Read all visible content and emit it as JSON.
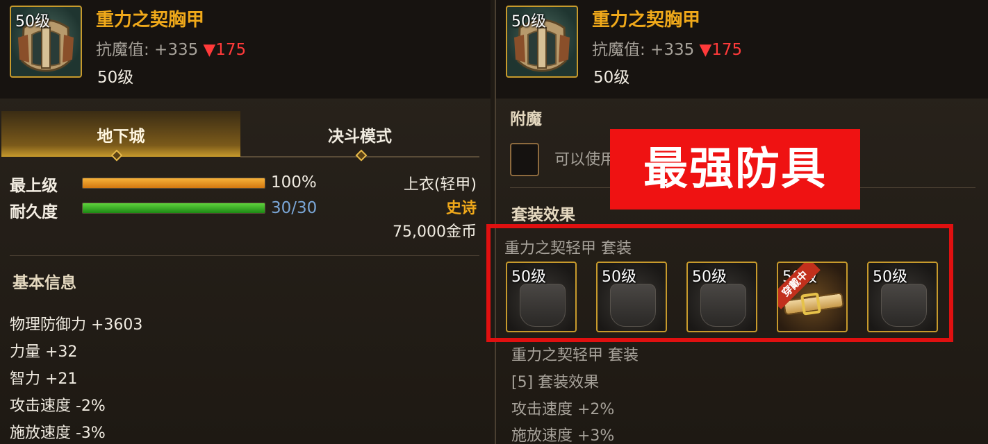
{
  "left_panel": {
    "item": {
      "icon_level": "50级",
      "name": "重力之契胸甲",
      "stat_text": "抗魔值: +335",
      "stat_down": "▼175",
      "level": "50级"
    },
    "tabs": [
      {
        "label": "地下城",
        "active": true
      },
      {
        "label": "决斗模式",
        "active": false
      }
    ],
    "grade": {
      "label": "最上级",
      "value_text": "100%",
      "percent": 100,
      "value_color": "#f1ece2"
    },
    "durability": {
      "label": "耐久度",
      "value_text": "30/30",
      "percent": 100,
      "value_color": "#7aa6d6"
    },
    "type": {
      "slot": "上衣(轻甲)",
      "rarity": "史诗",
      "rarity_color": "#f0a91a",
      "price": "75,000金币"
    },
    "basic_info": {
      "title": "基本信息",
      "lines": [
        "物理防御力 +3603",
        "力量 +32",
        "智力 +21",
        "攻击速度 -2%",
        "施放速度 -3%"
      ]
    }
  },
  "right_panel": {
    "item": {
      "icon_level": "50级",
      "name": "重力之契胸甲",
      "stat_text": "抗魔值: +335",
      "stat_down": "▼175",
      "level": "50级"
    },
    "enchant": {
      "title": "附魔",
      "text": "可以使用"
    },
    "banner": "最强防具",
    "set": {
      "title": "套装效果",
      "name": "重力之契轻甲 套装",
      "slots": [
        {
          "level": "50级",
          "equipped": false
        },
        {
          "level": "50级",
          "equipped": false
        },
        {
          "level": "50级",
          "equipped": false
        },
        {
          "level": "50级",
          "equipped": true,
          "tag": "穿戴中"
        },
        {
          "level": "50级",
          "equipped": false
        }
      ],
      "lines": [
        "重力之契轻甲 套装",
        "[5] 套装效果",
        "攻击速度 +2%",
        "施放速度 +3%"
      ]
    }
  },
  "colors": {
    "accent_gold": "#c79a2c",
    "name_orange": "#f0a91a",
    "alert_red": "#ef1212"
  }
}
